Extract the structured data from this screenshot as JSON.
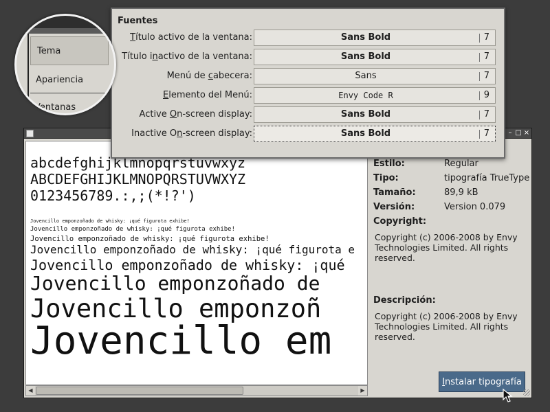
{
  "fonts_dialog": {
    "heading": "Fuentes",
    "rows": [
      {
        "label_pre": "",
        "label_key": "T",
        "label_post": "ítulo activo de la ventana:",
        "font": "Sans Bold",
        "size": "7"
      },
      {
        "label_pre": "Título i",
        "label_key": "n",
        "label_post": "activo de la ventana:",
        "font": "Sans Bold",
        "size": "7"
      },
      {
        "label_pre": "Menú de ",
        "label_key": "c",
        "label_post": "abecera:",
        "font": "Sans",
        "size": "7"
      },
      {
        "label_pre": "",
        "label_key": "E",
        "label_post": "lemento del Menú:",
        "font": "Envy Code R",
        "size": "9"
      },
      {
        "label_pre": "Active ",
        "label_key": "O",
        "label_post": "n-screen display:",
        "font": "Sans Bold",
        "size": "7"
      },
      {
        "label_pre": "Inactive O",
        "label_key": "n",
        "label_post": "-screen display:",
        "font": "Sans Bold",
        "size": "7"
      }
    ]
  },
  "magnifier": {
    "items": [
      "Tema",
      "Apariencia",
      "Ventanas"
    ]
  },
  "viewer": {
    "samples": {
      "lowercase": "abcdefghijklmnopqrstuvwxyz",
      "uppercase": "ABCDEFGHIJKLMNOPQRSTUVWXYZ",
      "digits": "0123456789.:,;(*!?')",
      "pangram": "Jovencillo emponzoñado de whisky: ¡qué figurota exhibe!",
      "pangram_short": "Jovencillo emponzoñado de whisky: ¡qué figurota e",
      "pangram_medium": "Jovencillo emponzoñado de whisky: ¡qué",
      "pangram_large1": "Jovencillo emponzoñado de",
      "pangram_large2": "Jovencillo emponzoñ",
      "pangram_large3": "Jovencillo em"
    },
    "info": {
      "style_label": "Estilo:",
      "style_value": "Regular",
      "type_label": "Tipo:",
      "type_value": "tipografía TrueType",
      "size_label": "Tamaño:",
      "size_value": "89,9 kB",
      "version_label": "Versión:",
      "version_value": "Version 0.079",
      "copyright_label": "Copyright:",
      "copyright_value": "Copyright (c) 2006-2008 by Envy Technologies Limited. All rights reserved.",
      "description_label": "Descripción:",
      "description_value": "Copyright (c) 2006-2008 by Envy Technologies Limited. All rights reserved."
    },
    "install_button_pre": "I",
    "install_button_post": "nstalar tipografía",
    "window_buttons": {
      "minimize": "–",
      "maximize": "□",
      "close": "×"
    },
    "scroll_left": "◀",
    "scroll_right": "▶"
  }
}
